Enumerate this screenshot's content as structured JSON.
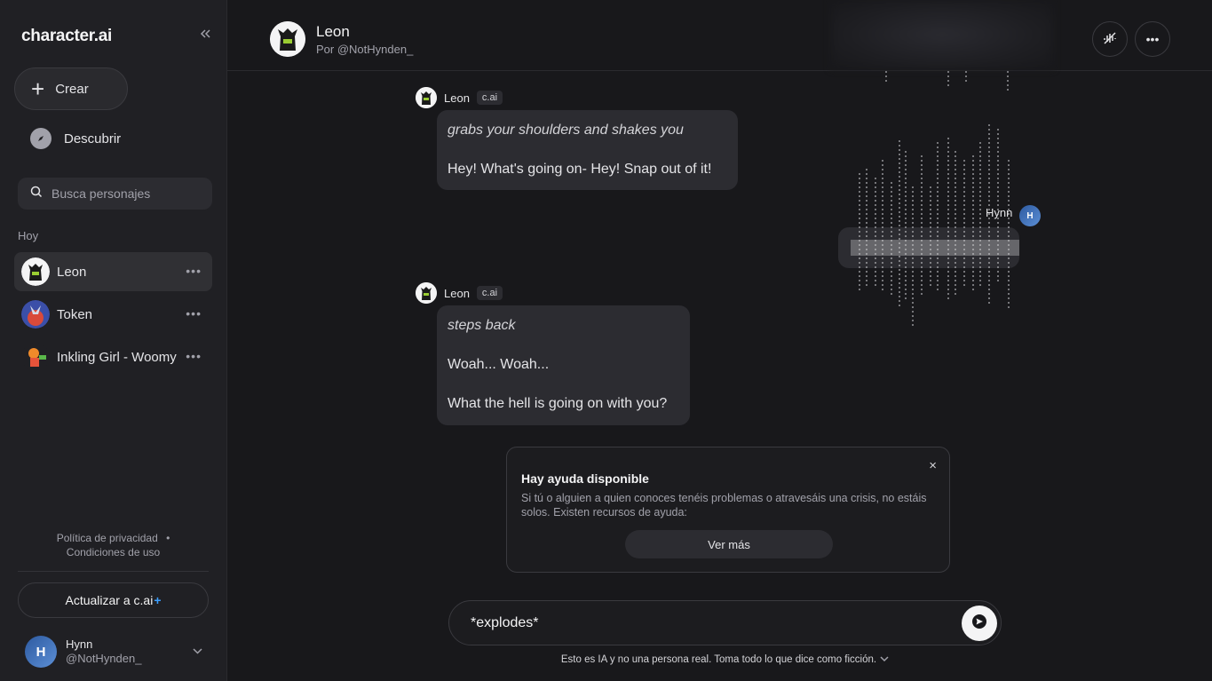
{
  "sidebar": {
    "logo": "character.ai",
    "collapse_icon": "collapse-icon",
    "create_label": "Crear",
    "discover_label": "Descubrir",
    "search_placeholder": "Busca personajes",
    "section_today": "Hoy",
    "chats": [
      {
        "name": "Leon",
        "active": true
      },
      {
        "name": "Token",
        "active": false
      },
      {
        "name": "Inkling Girl - Woomy",
        "active": false
      }
    ],
    "privacy": "Política de privacidad",
    "separator": "•",
    "terms": "Condiciones de uso",
    "upgrade_label": "Actualizar a c.ai",
    "upgrade_plus": "+",
    "profile": {
      "initial": "H",
      "name": "Hynn",
      "handle": "@NotHynden_"
    }
  },
  "header": {
    "title": "Leon",
    "subtitle": "Por @NotHynden_",
    "buttons": [
      "voice-icon",
      "more-icon"
    ]
  },
  "messages": [
    {
      "sender": "Leon",
      "badge": "c.ai",
      "lines": [
        "grabs your shoulders and shakes you",
        "Hey! What's going on- Hey! Snap out of it!"
      ]
    },
    {
      "sender": "Hynn",
      "initial": "H"
    },
    {
      "sender": "Leon",
      "badge": "c.ai",
      "lines": [
        "steps back",
        "Woah... Woah...",
        "What the hell is going on with you?"
      ]
    }
  ],
  "help_card": {
    "title": "Hay ayuda disponible",
    "description": "Si tú o alguien a quien conoces tenéis problemas o atravesáis una crisis, no estáis solos. Existen recursos de ayuda:",
    "button": "Ver más",
    "close": "×"
  },
  "composer": {
    "value": "*explodes*",
    "send_icon": "send-icon"
  },
  "disclaimer": "Esto es IA y no una persona real. Toma todo lo que dice como ficción."
}
